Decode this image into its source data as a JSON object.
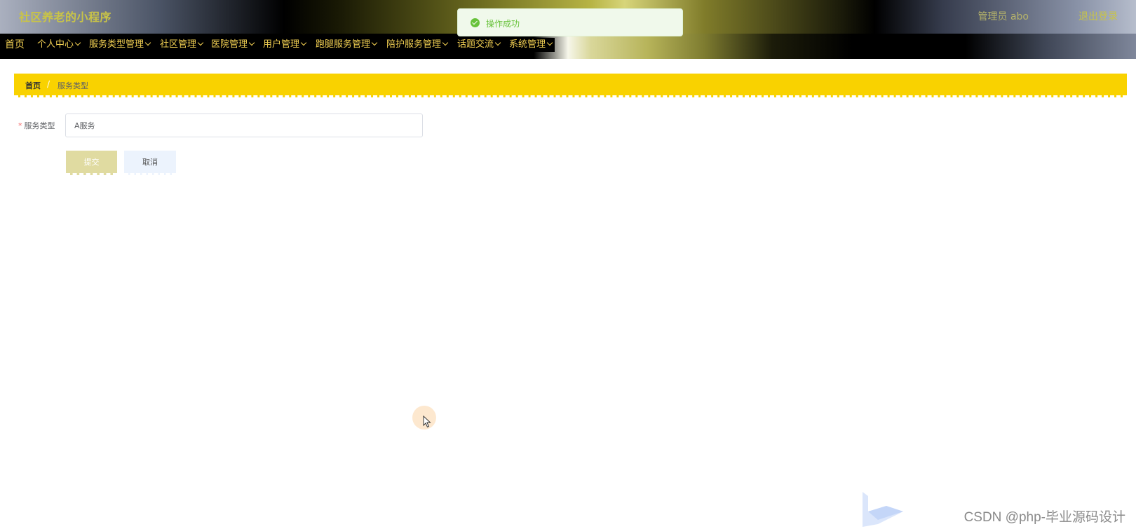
{
  "header": {
    "app_title": "社区养老的小程序",
    "user_label": "管理员 abo",
    "logout_label": "退出登录"
  },
  "toast": {
    "message": "操作成功",
    "icon": "check-circle-icon",
    "color": "#67c23a"
  },
  "nav": {
    "items": [
      {
        "label": "首页",
        "has_dropdown": false
      },
      {
        "label": "个人中心",
        "has_dropdown": true
      },
      {
        "label": "服务类型管理",
        "has_dropdown": true
      },
      {
        "label": "社区管理",
        "has_dropdown": true
      },
      {
        "label": "医院管理",
        "has_dropdown": true
      },
      {
        "label": "用户管理",
        "has_dropdown": true
      },
      {
        "label": "跑腿服务管理",
        "has_dropdown": true
      },
      {
        "label": "陪护服务管理",
        "has_dropdown": true
      },
      {
        "label": "话题交流",
        "has_dropdown": true
      },
      {
        "label": "系统管理",
        "has_dropdown": true
      }
    ]
  },
  "breadcrumb": {
    "home": "首页",
    "separator": "/",
    "current": "服务类型"
  },
  "form": {
    "required_mark": "*",
    "field_label": "服务类型",
    "field_value": "A服务",
    "submit_label": "提交",
    "cancel_label": "取消"
  },
  "watermark": {
    "text": "CSDN @php-毕业源码设计"
  },
  "colors": {
    "accent_yellow": "#f9d200",
    "nav_text": "#f1cf52",
    "title_text": "#c9c447"
  }
}
